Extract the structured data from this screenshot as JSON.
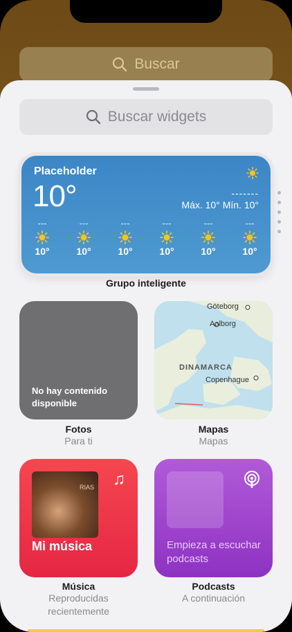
{
  "top_search": {
    "placeholder": "Buscar"
  },
  "sheet": {
    "search_placeholder": "Buscar widgets",
    "smart_stack": {
      "caption": "Grupo inteligente",
      "weather": {
        "location": "Placeholder",
        "temperature": "10°",
        "condition": "-------",
        "range": "Máx. 10° Mín. 10°",
        "hours": [
          {
            "hour": "---",
            "temp": "10°"
          },
          {
            "hour": "---",
            "temp": "10°"
          },
          {
            "hour": "---",
            "temp": "10°"
          },
          {
            "hour": "---",
            "temp": "10°"
          },
          {
            "hour": "---",
            "temp": "10°"
          },
          {
            "hour": "---",
            "temp": "10°"
          }
        ]
      }
    },
    "widgets": {
      "photos": {
        "message": "No hay contenido disponible",
        "title": "Fotos",
        "subtitle": "Para ti"
      },
      "maps": {
        "title": "Mapas",
        "subtitle": "Mapas",
        "labels": {
          "city1": "Göteborg",
          "city2": "Aalborg",
          "country": "DINAMARCA",
          "city3": "Copenhague"
        }
      },
      "music": {
        "tile_title": "Mi música",
        "title": "Música",
        "subtitle": "Reproducidas recientemente"
      },
      "podcasts": {
        "tile_text": "Empieza a escuchar podcasts",
        "title": "Podcasts",
        "subtitle": "A continuación"
      }
    }
  },
  "colors": {
    "weather_bg": "#3c86c6",
    "music_bg": "#e52644",
    "podcasts_bg": "#9b40cc",
    "photos_bg": "#6f6f71",
    "sun": "#f5c518"
  },
  "icons": [
    "search-icon",
    "sun-icon",
    "music-note-icon",
    "podcast-icon"
  ]
}
